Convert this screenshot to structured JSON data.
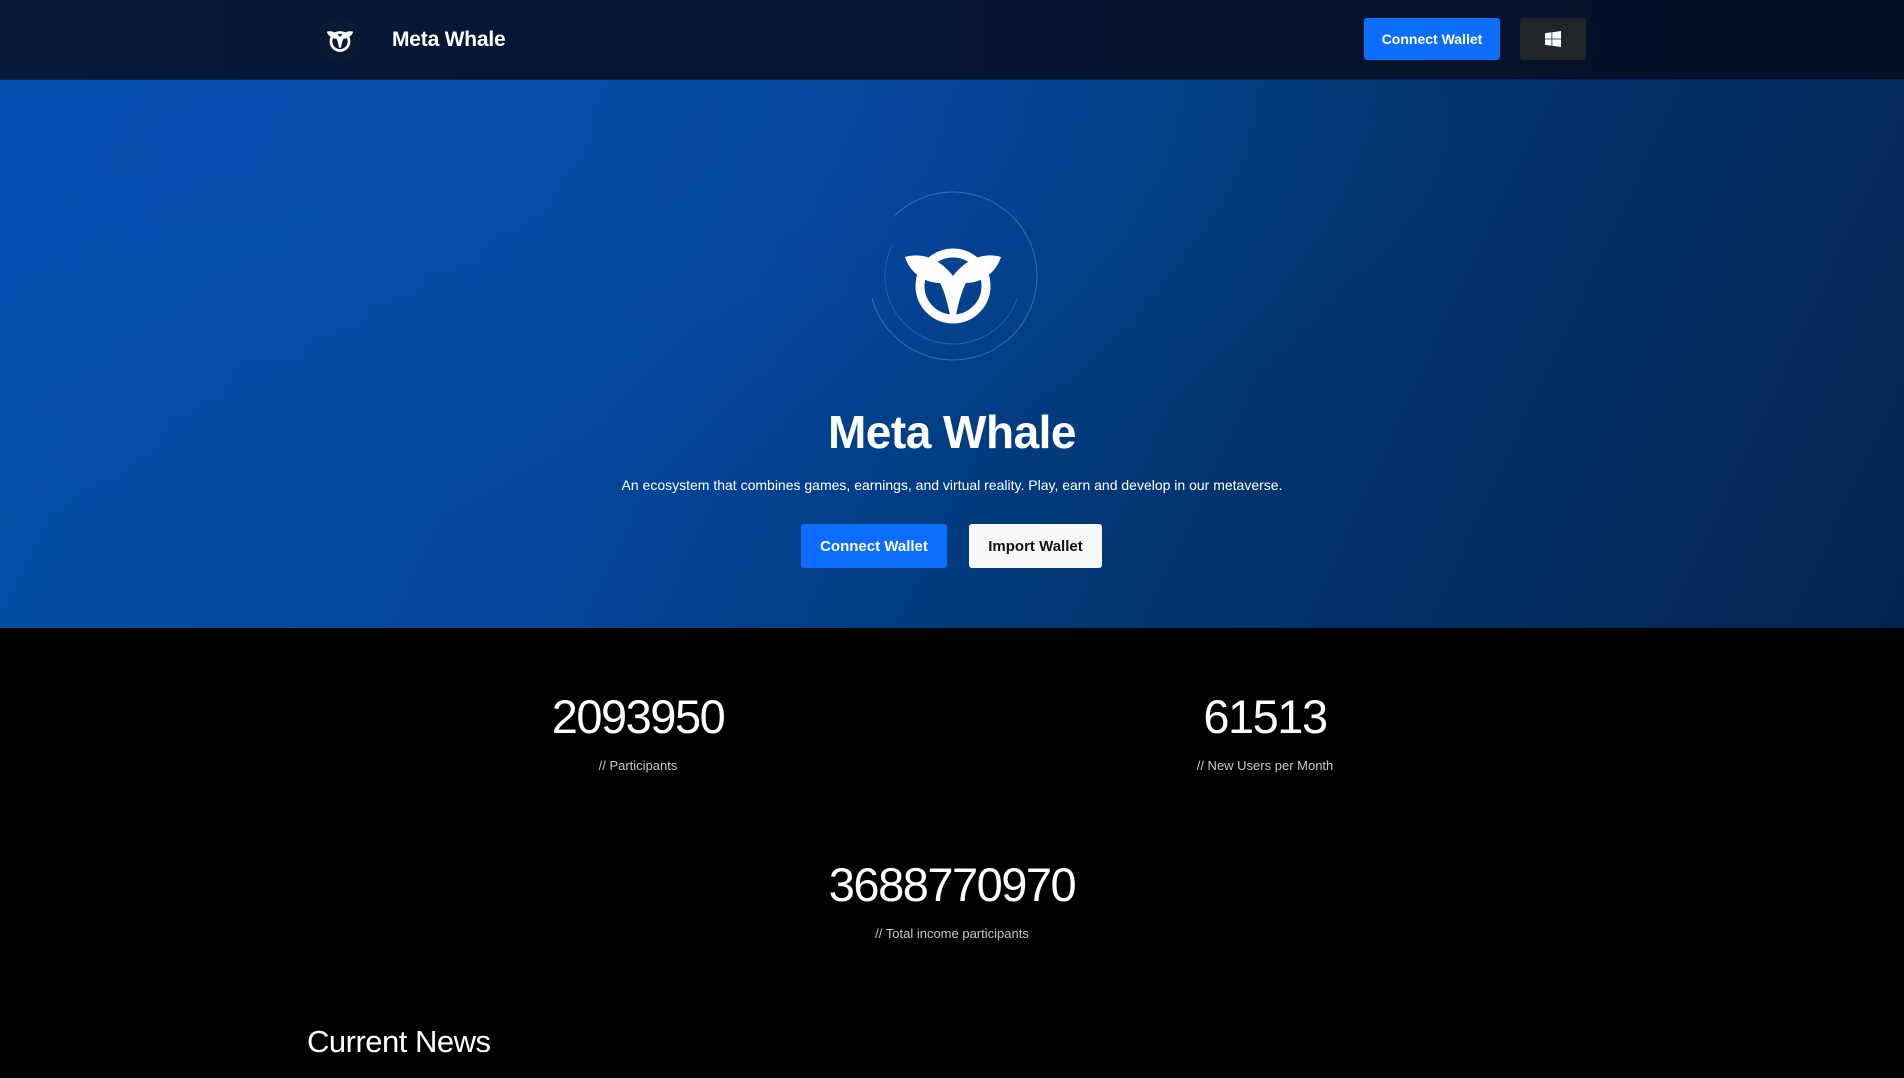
{
  "header": {
    "brand_name": "Meta Whale",
    "logo_icon": "whale-tail-icon",
    "connect_label": "Connect Wallet",
    "windows_icon": "windows-icon"
  },
  "hero": {
    "emblem_icon": "whale-tail-icon",
    "title": "Meta Whale",
    "subtitle": "An ecosystem that combines games, earnings, and virtual reality. Play, earn and develop in our metaverse.",
    "connect_label": "Connect Wallet",
    "import_label": "Import Wallet"
  },
  "stats": [
    {
      "value": "2093950",
      "label": "// Participants"
    },
    {
      "value": "61513",
      "label": "// New Users per Month"
    },
    {
      "value": "3688770970",
      "label": "// Total income participants"
    }
  ],
  "news": {
    "title": "Current News"
  },
  "colors": {
    "primary": "#0d6efd",
    "header_bg": "#041430",
    "hero_bg": "#03479c",
    "page_bg": "#000000",
    "dark_button": "#212529"
  }
}
